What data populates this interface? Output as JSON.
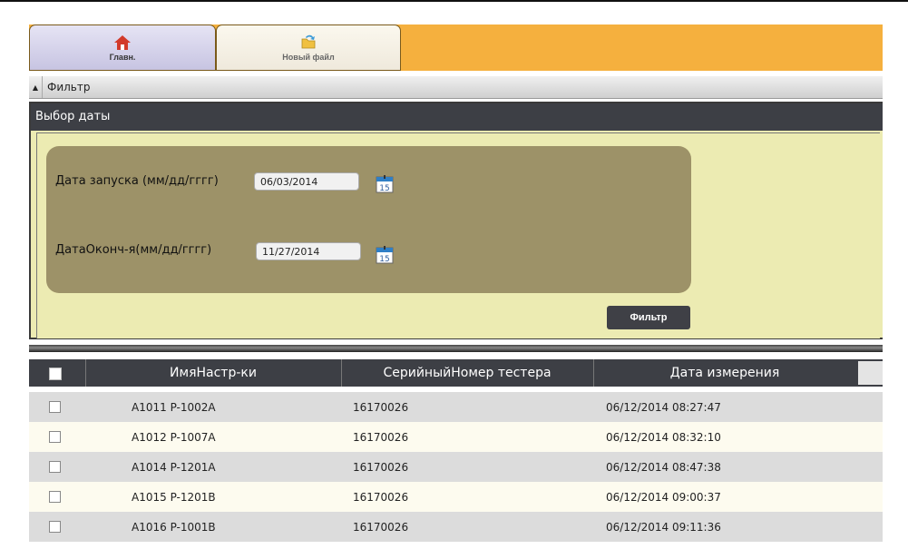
{
  "tabs": {
    "home": {
      "label": "Главн.",
      "icon": "home-icon"
    },
    "new_file": {
      "label": "Новый файл",
      "icon": "new-file-icon"
    }
  },
  "filter": {
    "title": "Фильтр",
    "panel_title": "Выбор даты",
    "start_label": "Дата запуска (мм/дд/гггг)",
    "start_value": "06/03/2014",
    "end_label": "ДатаОконч-я(мм/дд/гггг)",
    "end_value": "11/27/2014",
    "calendar_day": "15",
    "button": "Фильтр"
  },
  "grid": {
    "columns": [
      "ИмяНастр-ки",
      "СерийныйНомер тестера",
      "Дата измерения"
    ],
    "rows": [
      {
        "name": "A1011 P-1002A",
        "serial": "16170026",
        "date": "06/12/2014 08:27:47"
      },
      {
        "name": "A1012 P-1007A",
        "serial": "16170026",
        "date": "06/12/2014 08:32:10"
      },
      {
        "name": "A1014 P-1201A",
        "serial": "16170026",
        "date": "06/12/2014 08:47:38"
      },
      {
        "name": "A1015 P-1201B",
        "serial": "16170026",
        "date": "06/12/2014 09:00:37"
      },
      {
        "name": "A1016 P-1001B",
        "serial": "16170026",
        "date": "06/12/2014 09:11:36"
      }
    ]
  },
  "colors": {
    "tab_bar": "#f5b03e",
    "panel": "#ecebb2",
    "date_box": "#9d9268",
    "header": "#3d3f45"
  }
}
